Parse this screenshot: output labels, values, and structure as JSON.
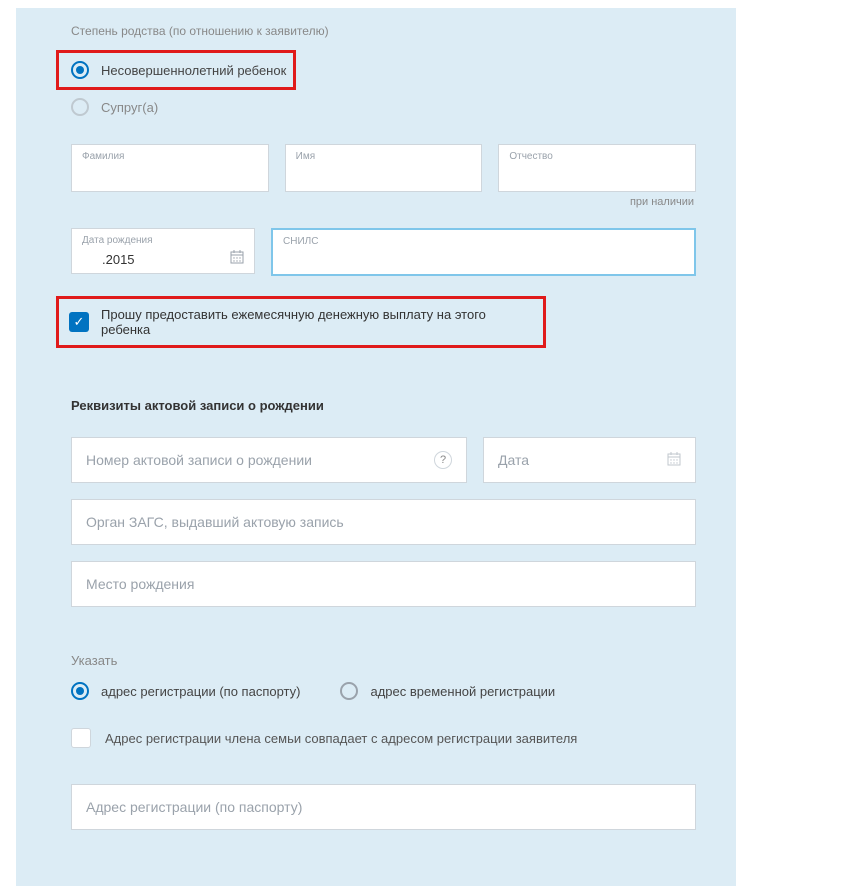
{
  "relationship": {
    "label": "Степень родства (по отношению к заявителю)",
    "options": {
      "minor": "Несовершеннолетний ребенок",
      "spouse": "Супруг(а)"
    }
  },
  "name_fields": {
    "surname": "Фамилия",
    "first_name": "Имя",
    "patronymic": "Отчество",
    "patronymic_hint": "при наличии"
  },
  "birth": {
    "date_label": "Дата рождения",
    "date_value": ".2015",
    "snils_label": "СНИЛС"
  },
  "payment_request": "Прошу предоставить ежемесячную денежную выплату на этого ребенка",
  "birth_record": {
    "title": "Реквизиты актовой записи о рождении",
    "number_placeholder": "Номер актовой записи о рождении",
    "date_placeholder": "Дата",
    "authority_placeholder": "Орган ЗАГС, выдавший актовую запись",
    "birthplace_placeholder": "Место рождения"
  },
  "address": {
    "specify": "Указать",
    "registration": "адрес регистрации (по паспорту)",
    "temporary": "адрес временной регистрации",
    "same_as_applicant": "Адрес регистрации члена семьи совпадает с адресом регистрации заявителя",
    "input_placeholder": "Адрес регистрации (по паспорту)"
  }
}
